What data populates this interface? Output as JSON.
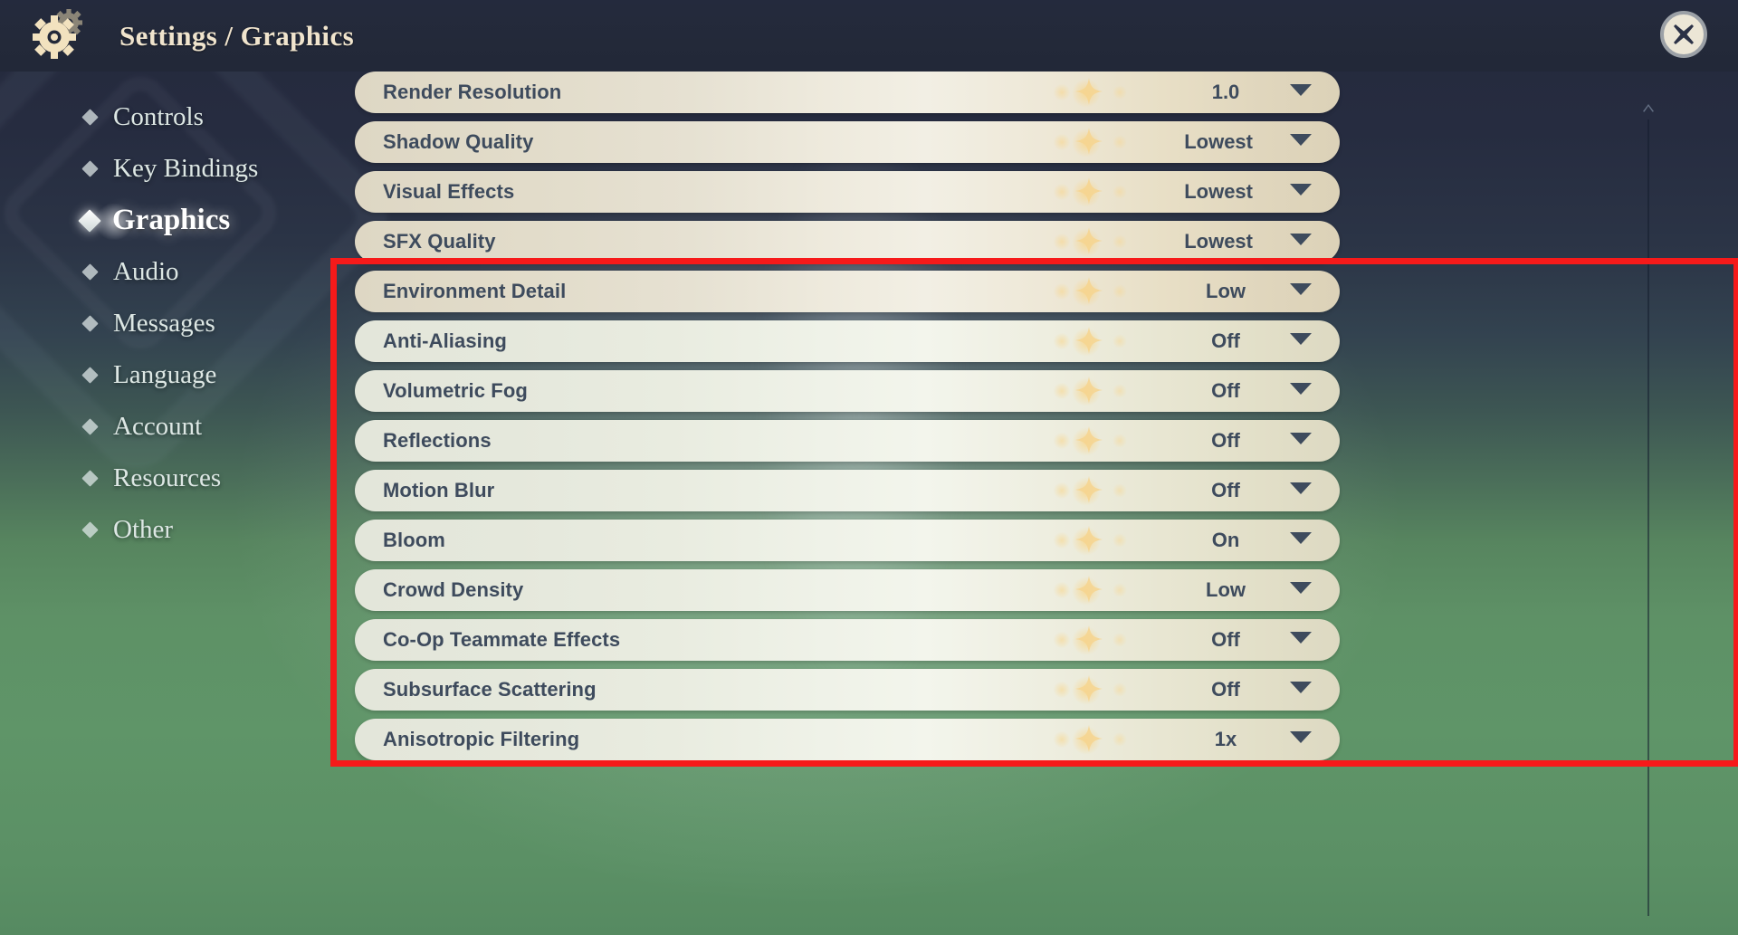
{
  "header": {
    "title": "Settings / Graphics",
    "gear_icon": "gear-icon",
    "close_icon": "close-icon",
    "accent_color": "#f0e4cd",
    "bar_color": "#232939"
  },
  "sidebar": {
    "items": [
      {
        "label": "Controls",
        "active": false
      },
      {
        "label": "Key Bindings",
        "active": false
      },
      {
        "label": "Graphics",
        "active": true
      },
      {
        "label": "Audio",
        "active": false
      },
      {
        "label": "Messages",
        "active": false
      },
      {
        "label": "Language",
        "active": false
      },
      {
        "label": "Account",
        "active": false
      },
      {
        "label": "Resources",
        "active": false
      },
      {
        "label": "Other",
        "active": false
      }
    ]
  },
  "settings": {
    "rows": [
      {
        "label": "Render Resolution",
        "value": "1.0",
        "cool": false,
        "highlighted": false
      },
      {
        "label": "Shadow Quality",
        "value": "Lowest",
        "cool": false,
        "highlighted": false
      },
      {
        "label": "Visual Effects",
        "value": "Lowest",
        "cool": false,
        "highlighted": false
      },
      {
        "label": "SFX Quality",
        "value": "Lowest",
        "cool": false,
        "highlighted": false
      },
      {
        "label": "Environment Detail",
        "value": "Low",
        "cool": false,
        "highlighted": true
      },
      {
        "label": "Anti-Aliasing",
        "value": "Off",
        "cool": true,
        "highlighted": true
      },
      {
        "label": "Volumetric Fog",
        "value": "Off",
        "cool": true,
        "highlighted": true
      },
      {
        "label": "Reflections",
        "value": "Off",
        "cool": true,
        "highlighted": true
      },
      {
        "label": "Motion Blur",
        "value": "Off",
        "cool": true,
        "highlighted": true
      },
      {
        "label": "Bloom",
        "value": "On",
        "cool": true,
        "highlighted": true
      },
      {
        "label": "Crowd Density",
        "value": "Low",
        "cool": true,
        "highlighted": true
      },
      {
        "label": "Co-Op Teammate Effects",
        "value": "Off",
        "cool": true,
        "highlighted": true
      },
      {
        "label": "Subsurface Scattering",
        "value": "Off",
        "cool": true,
        "highlighted": true
      },
      {
        "label": "Anisotropic Filtering",
        "value": "1x",
        "cool": true,
        "highlighted": true
      }
    ],
    "dropdown_icon": "chevron-down-icon"
  },
  "scrollbar": {
    "up_icon": "chevron-up-icon"
  },
  "annotation": {
    "color": "#f61a1a",
    "shape": "rectangle"
  }
}
